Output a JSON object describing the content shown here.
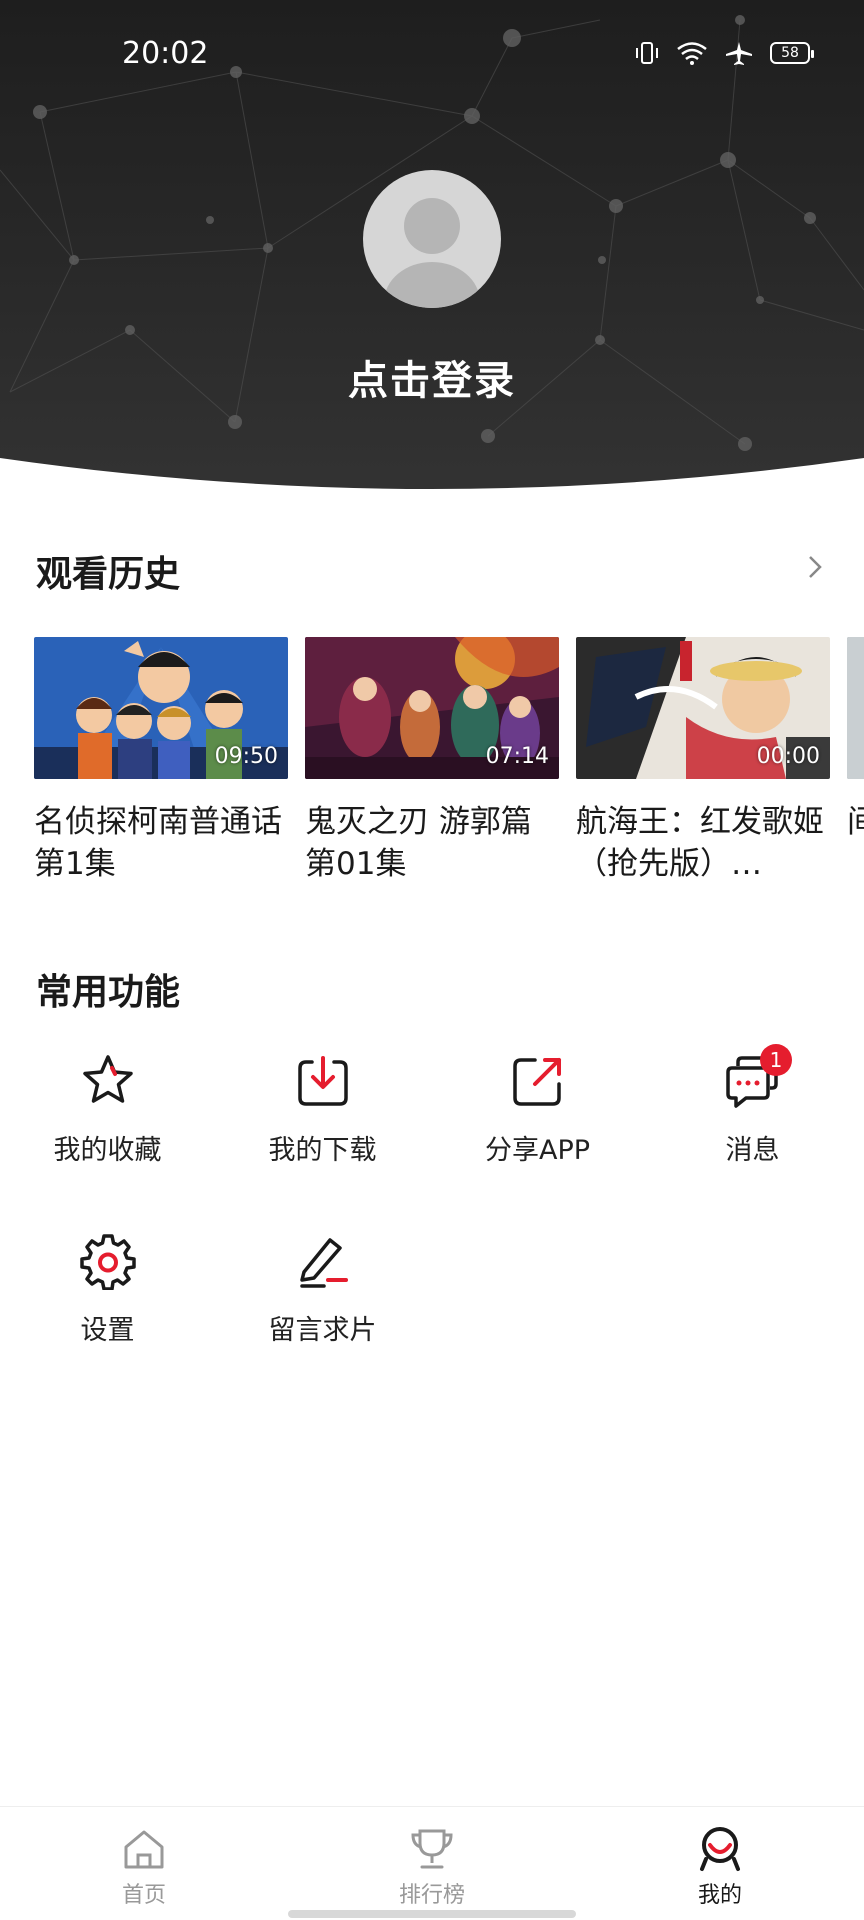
{
  "status_bar": {
    "time": "20:02",
    "battery": "58"
  },
  "profile": {
    "login_label": "点击登录"
  },
  "history": {
    "title": "观看历史",
    "items": [
      {
        "title": "名侦探柯南普通话 第1集",
        "duration": "09:50"
      },
      {
        "title": "鬼灭之刃 游郭篇第01集",
        "duration": "07:14"
      },
      {
        "title": "航海王：红发歌姬（抢先版）…",
        "duration": "00:00"
      },
      {
        "title": "间集",
        "duration": ""
      }
    ]
  },
  "functions": {
    "title": "常用功能",
    "items": [
      {
        "label": "我的收藏",
        "icon": "star-icon"
      },
      {
        "label": "我的下载",
        "icon": "download-icon"
      },
      {
        "label": "分享APP",
        "icon": "share-icon"
      },
      {
        "label": "消息",
        "icon": "message-icon",
        "badge": "1"
      },
      {
        "label": "设置",
        "icon": "gear-icon"
      },
      {
        "label": "留言求片",
        "icon": "edit-icon"
      }
    ]
  },
  "bottom_nav": {
    "items": [
      {
        "label": "首页",
        "icon": "home-icon",
        "active": false
      },
      {
        "label": "排行榜",
        "icon": "trophy-icon",
        "active": false
      },
      {
        "label": "我的",
        "icon": "profile-icon",
        "active": true
      }
    ]
  },
  "colors": {
    "accent": "#e51d2e",
    "inactive_nav": "#999999",
    "active_nav": "#1a1a1a"
  }
}
